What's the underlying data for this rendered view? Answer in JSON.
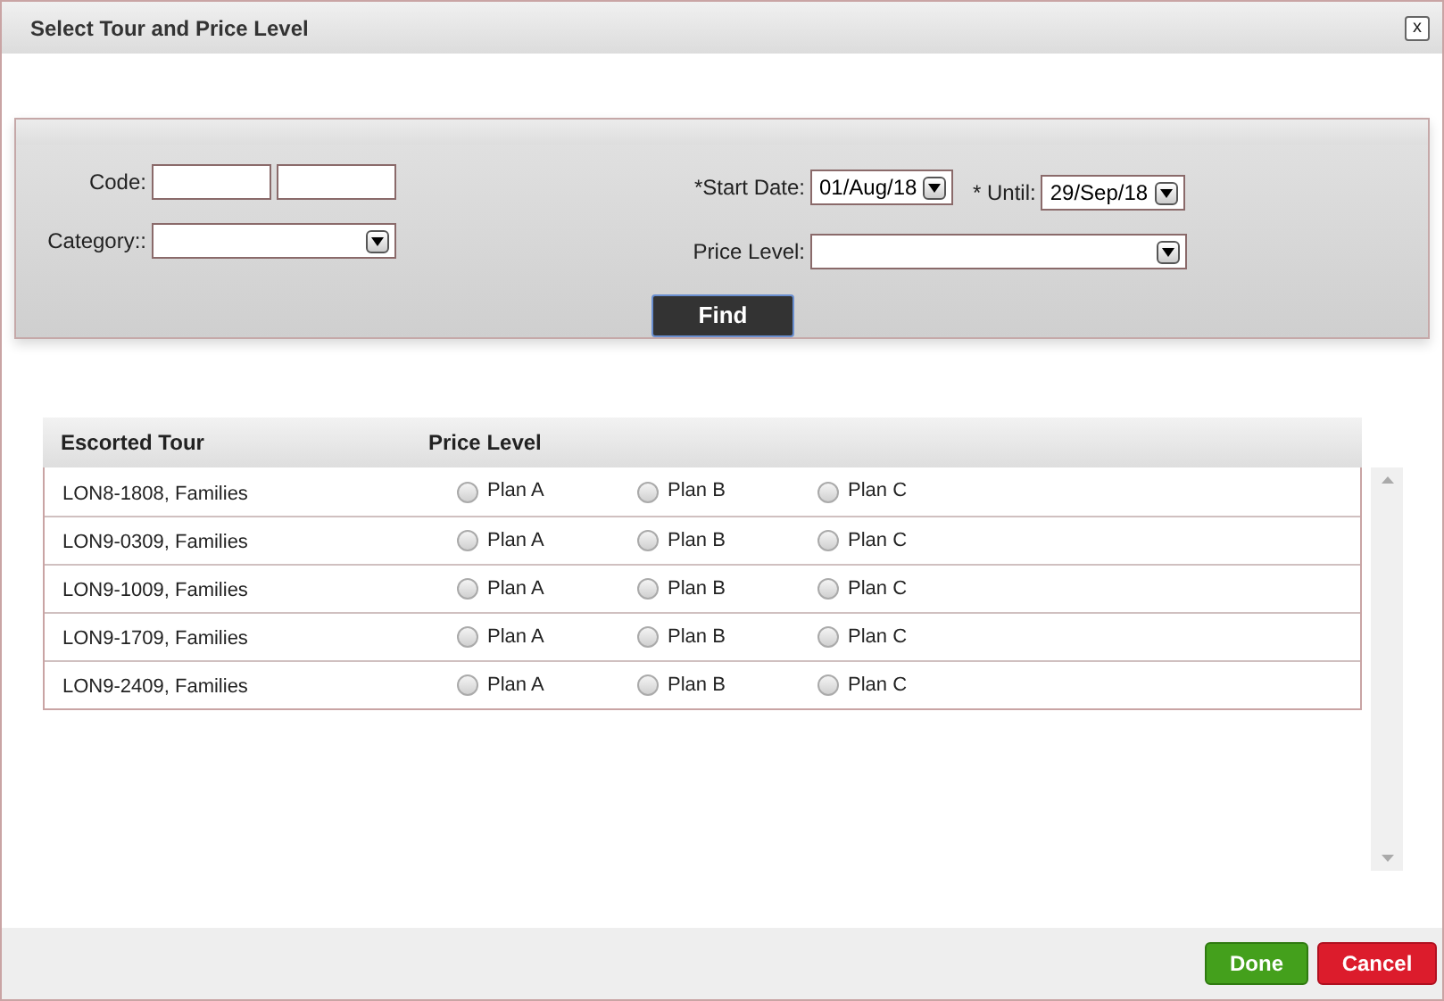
{
  "window": {
    "title": "Select Tour and Price Level",
    "close_icon": "x"
  },
  "filters": {
    "code_label": "Code:",
    "category_label": "Category::",
    "start_date_label": "*Start Date:",
    "start_date": "01/Aug/18",
    "until_label": "* Until:",
    "until": "29/Sep/18",
    "price_level_label": "Price Level:",
    "find_button": "Find"
  },
  "table": {
    "columns": [
      "Escorted Tour",
      "Price Level"
    ],
    "rows": [
      {
        "tour": "LON8-1808, Families",
        "plans": [
          {
            "label": "Plan A",
            "selected": false
          },
          {
            "label": "Plan B",
            "selected": false
          },
          {
            "label": "Plan C",
            "selected": false
          }
        ]
      },
      {
        "tour": "LON9-0309, Families",
        "plans": [
          {
            "label": "Plan A",
            "selected": false
          },
          {
            "label": "Plan B",
            "selected": false
          },
          {
            "label": "Plan C",
            "selected": false
          }
        ]
      },
      {
        "tour": "LON9-1009, Families",
        "plans": [
          {
            "label": "Plan A",
            "selected": false
          },
          {
            "label": "Plan B",
            "selected": false
          },
          {
            "label": "Plan C",
            "selected": false
          }
        ]
      },
      {
        "tour": "LON9-1709, Families",
        "plans": [
          {
            "label": "Plan A",
            "selected": false
          },
          {
            "label": "Plan B",
            "selected": false
          },
          {
            "label": "Plan C",
            "selected": false
          }
        ]
      },
      {
        "tour": "LON9-2409, Families",
        "plans": [
          {
            "label": "Plan A",
            "selected": false
          },
          {
            "label": "Plan B",
            "selected": false
          },
          {
            "label": "Plan C",
            "selected": false
          }
        ]
      }
    ]
  },
  "buttons": {
    "done": "Done",
    "cancel": "Cancel"
  }
}
